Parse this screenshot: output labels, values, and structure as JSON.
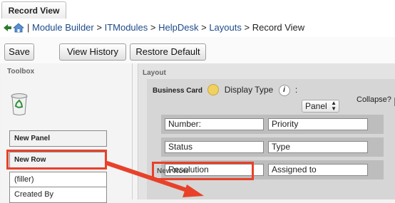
{
  "tab": {
    "title": "Record View"
  },
  "breadcrumb": {
    "separator": "|",
    "items": [
      "Module Builder",
      "ITModules",
      "HelpDesk",
      "Layouts",
      "Record View"
    ],
    "delim": ">"
  },
  "toolbar": {
    "save": "Save",
    "view_history": "View History",
    "restore_default": "Restore Default"
  },
  "toolbox": {
    "title": "Toolbox",
    "trash_icon": "recycle-bin-icon",
    "items": [
      "New Panel",
      "New Row",
      "(filler)",
      "Created By"
    ]
  },
  "layout": {
    "title": "Layout",
    "panel_name": "Business Card",
    "display_type_label": "Display Type",
    "display_type_value": "Panel",
    "collapse_label": "Collapse?",
    "rows": [
      [
        "Number:",
        "Priority"
      ],
      [
        "Status",
        "Type"
      ],
      [
        "Resolution",
        "Assigned to"
      ]
    ],
    "new_row_label": "New Row"
  },
  "colors": {
    "highlight": "#e8412a",
    "link": "#1d4a8a"
  }
}
